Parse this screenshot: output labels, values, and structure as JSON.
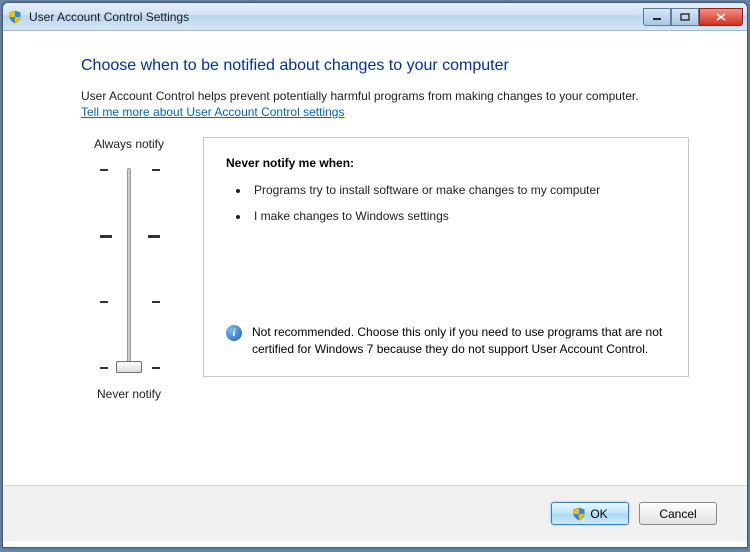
{
  "window": {
    "title": "User Account Control Settings"
  },
  "content": {
    "heading": "Choose when to be notified about changes to your computer",
    "description": "User Account Control helps prevent potentially harmful programs from making changes to your computer.",
    "link_text": "Tell me more about User Account Control settings"
  },
  "slider": {
    "top_label": "Always notify",
    "bottom_label": "Never notify",
    "position": 3,
    "levels": 4
  },
  "info": {
    "title": "Never notify me when:",
    "bullets": [
      "Programs try to install software or make changes to my computer",
      "I make changes to Windows settings"
    ],
    "warning": "Not recommended. Choose this only if you need to use programs that are not certified for Windows 7 because they do not support User Account Control."
  },
  "footer": {
    "ok_label": "OK",
    "cancel_label": "Cancel"
  }
}
